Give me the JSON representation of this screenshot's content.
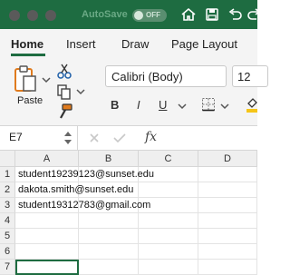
{
  "titlebar": {
    "autosave_label": "AutoSave",
    "autosave_state": "OFF",
    "icons": [
      "home-icon",
      "save-icon",
      "undo-icon",
      "redo-icon"
    ]
  },
  "tabs": [
    {
      "label": "Home",
      "active": true
    },
    {
      "label": "Insert"
    },
    {
      "label": "Draw"
    },
    {
      "label": "Page Layout"
    }
  ],
  "ribbon": {
    "paste_label": "Paste",
    "font_name": "Calibri (Body)",
    "font_size": "12",
    "bold": "B",
    "italic": "I",
    "underline": "U"
  },
  "formula": {
    "name_box": "E7",
    "fx": "fx"
  },
  "sheet": {
    "columns": [
      "A",
      "B",
      "C",
      "D"
    ],
    "rows": [
      "1",
      "2",
      "3",
      "4",
      "5",
      "6",
      "7"
    ],
    "cells": {
      "A1": "student19239123@sunset.edu",
      "A2": "dakota.smith@sunset.edu",
      "A3": "student19312783@gmail.com"
    }
  },
  "colors": {
    "accent": "#1e6c41"
  }
}
